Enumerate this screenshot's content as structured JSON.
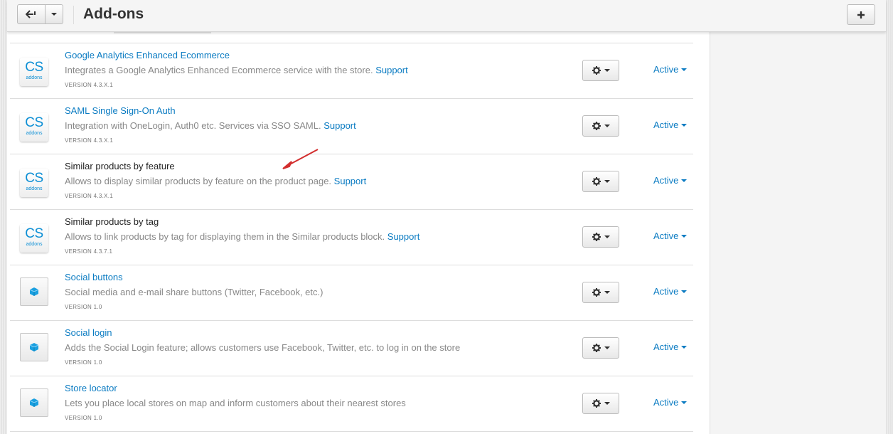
{
  "header": {
    "title": "Add-ons",
    "back_icon": "back-arrow-icon",
    "add_icon": "plus-icon"
  },
  "addons": [
    {
      "name": "Google Analytics Enhanced Ecommerce",
      "desc": "Integrates a Google Analytics Enhanced Ecommerce service with the store.",
      "support": "Support",
      "version": "VERSION 4.3.X.1",
      "logo": "cs",
      "status": "Active",
      "name_style": "link"
    },
    {
      "name": "SAML Single Sign-On Auth",
      "desc": "Integration with OneLogin, Auth0 etc. Services via SSO SAML.",
      "support": "Support",
      "version": "VERSION 4.3.X.1",
      "logo": "cs",
      "status": "Active",
      "name_style": "link"
    },
    {
      "name": "Similar products by feature",
      "desc": "Allows to display similar products by feature on the product page.",
      "support": "Support",
      "version": "VERSION 4.3.X.1",
      "logo": "cs",
      "status": "Active",
      "name_style": "plain"
    },
    {
      "name": "Similar products by tag",
      "desc": "Allows to link products by tag for displaying them in the Similar products block.",
      "support": "Support",
      "version": "VERSION 4.3.7.1",
      "logo": "cs",
      "status": "Active",
      "name_style": "plain"
    },
    {
      "name": "Social buttons",
      "desc": "Social media and e-mail share buttons (Twitter, Facebook, etc.)",
      "support": "",
      "version": "VERSION 1.0",
      "logo": "box",
      "status": "Active",
      "name_style": "link"
    },
    {
      "name": "Social login",
      "desc": "Adds the Social Login feature; allows customers use Facebook, Twitter, etc. to log in on the store",
      "support": "",
      "version": "VERSION 1.0",
      "logo": "box",
      "status": "Active",
      "name_style": "link"
    },
    {
      "name": "Store locator",
      "desc": "Lets you place local stores on map and inform customers about their nearest stores",
      "support": "",
      "version": "VERSION 1.0",
      "logo": "box",
      "status": "Active",
      "name_style": "link"
    }
  ],
  "logo_text": {
    "cs": "CS",
    "sub": "addons"
  },
  "colors": {
    "link": "#0a7bc2",
    "accent": "#0d8fd5",
    "annotation": "#d32f2f"
  }
}
